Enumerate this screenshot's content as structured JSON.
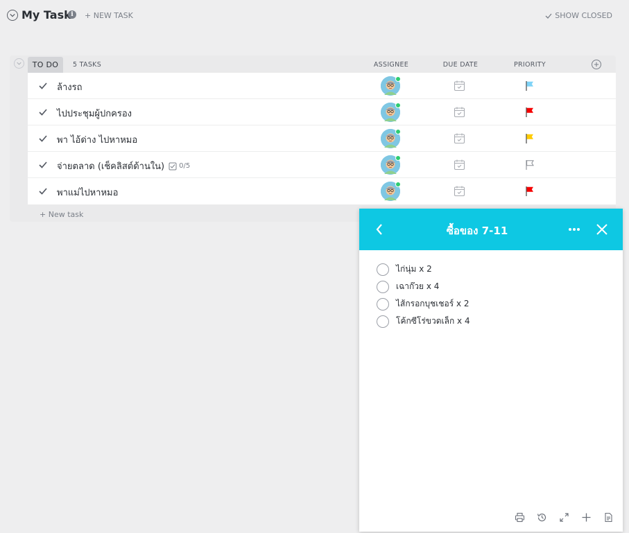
{
  "header": {
    "title": "My Task",
    "info_glyph": "i",
    "new_task_label": "+ NEW TASK",
    "show_closed_label": "SHOW CLOSED"
  },
  "group": {
    "status": "TO DO",
    "count": "5 TASKS",
    "columns": {
      "assignee": "ASSIGNEE",
      "due_date": "DUE DATE",
      "priority": "PRIORITY"
    },
    "new_task_label": "+ New task"
  },
  "tasks": [
    {
      "name": "ล้างรถ",
      "priority_color": "#7fd3f7"
    },
    {
      "name": "ไปประชุมผู้ปกครอง",
      "priority_color": "#f50000"
    },
    {
      "name": "พา ไอ้ด่าง ไปหาหมอ",
      "priority_color": "#ffcc00"
    },
    {
      "name": "จ่ายตลาด (เช็คลิสต์ด้านใน)",
      "subtasks": "0/5",
      "priority_color": "none"
    },
    {
      "name": "พาแม่ไปหาหมอ",
      "priority_color": "#f50000"
    }
  ],
  "panel": {
    "title": "ซื้อของ 7-11",
    "items": [
      "ไก่นุ่ม x 2",
      "เฉาก๊วย x 4",
      "ไส้กรอกบุชเชอร์ x 2",
      "โค้กซีโร่ขวดเล็ก x 4"
    ],
    "header_color": "#0ec8e3"
  }
}
